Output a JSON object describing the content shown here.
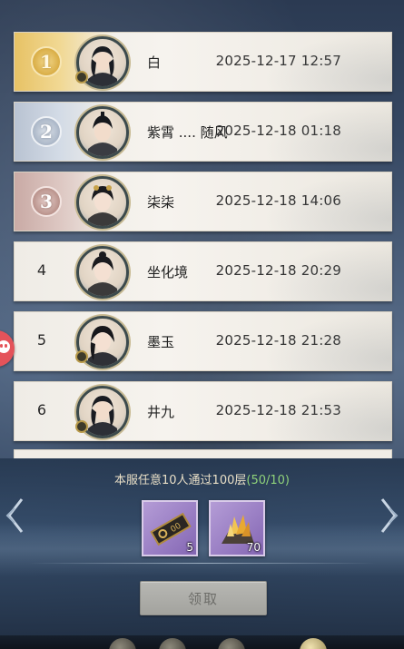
{
  "leaderboard": {
    "rows": [
      {
        "rank": "1",
        "name": "白",
        "time": "2025-12-17 12:57"
      },
      {
        "rank": "2",
        "name": "紫霄 .... 随风",
        "time": "2025-12-18 01:18"
      },
      {
        "rank": "3",
        "name": "柒柒",
        "time": "2025-12-18 14:06"
      },
      {
        "rank": "4",
        "name": "坐化境",
        "time": "2025-12-18 20:29"
      },
      {
        "rank": "5",
        "name": "墨玉",
        "time": "2025-12-18 21:28"
      },
      {
        "rank": "6",
        "name": "井九",
        "time": "2025-12-18 21:53"
      }
    ]
  },
  "task": {
    "text": "本服任意10人通过100层",
    "progress": "(50/10)"
  },
  "rewards": [
    {
      "icon": "ticket-icon",
      "count": "5"
    },
    {
      "icon": "crystal-ore-icon",
      "count": "70"
    }
  ],
  "claim_button": {
    "label": "领取",
    "state": "disabled"
  },
  "colors": {
    "gold": "#e7c265",
    "silver": "#b9c3d2",
    "bronze": "#c9aaa5",
    "progress_green": "#8fd27a",
    "reward_purple": "#9a7fc4"
  }
}
